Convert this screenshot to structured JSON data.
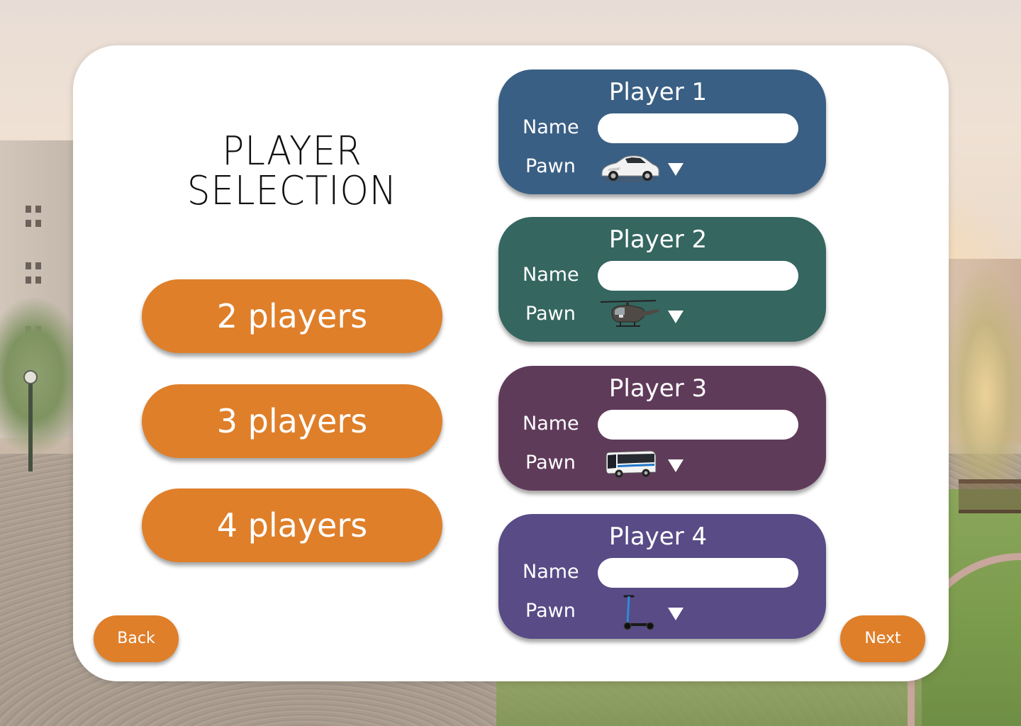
{
  "screen": {
    "title_line1": "PLAYER",
    "title_line2": "SELECTION"
  },
  "player_count_options": [
    {
      "label": "2 players"
    },
    {
      "label": "3 players"
    },
    {
      "label": "4 players"
    }
  ],
  "players": [
    {
      "title": "Player 1",
      "name_label": "Name",
      "name_value": "",
      "pawn_label": "Pawn",
      "pawn": "car-icon",
      "color": "#3a5f84"
    },
    {
      "title": "Player 2",
      "name_label": "Name",
      "name_value": "",
      "pawn_label": "Pawn",
      "pawn": "helicopter-icon",
      "color": "#356660"
    },
    {
      "title": "Player 3",
      "name_label": "Name",
      "name_value": "",
      "pawn_label": "Pawn",
      "pawn": "bus-icon",
      "color": "#5f3b5a"
    },
    {
      "title": "Player 4",
      "name_label": "Name",
      "name_value": "",
      "pawn_label": "Pawn",
      "pawn": "scooter-icon",
      "color": "#584b86"
    }
  ],
  "nav": {
    "back_label": "Back",
    "next_label": "Next"
  },
  "colors": {
    "accent": "#df7f2a",
    "card": "#ffffff"
  }
}
